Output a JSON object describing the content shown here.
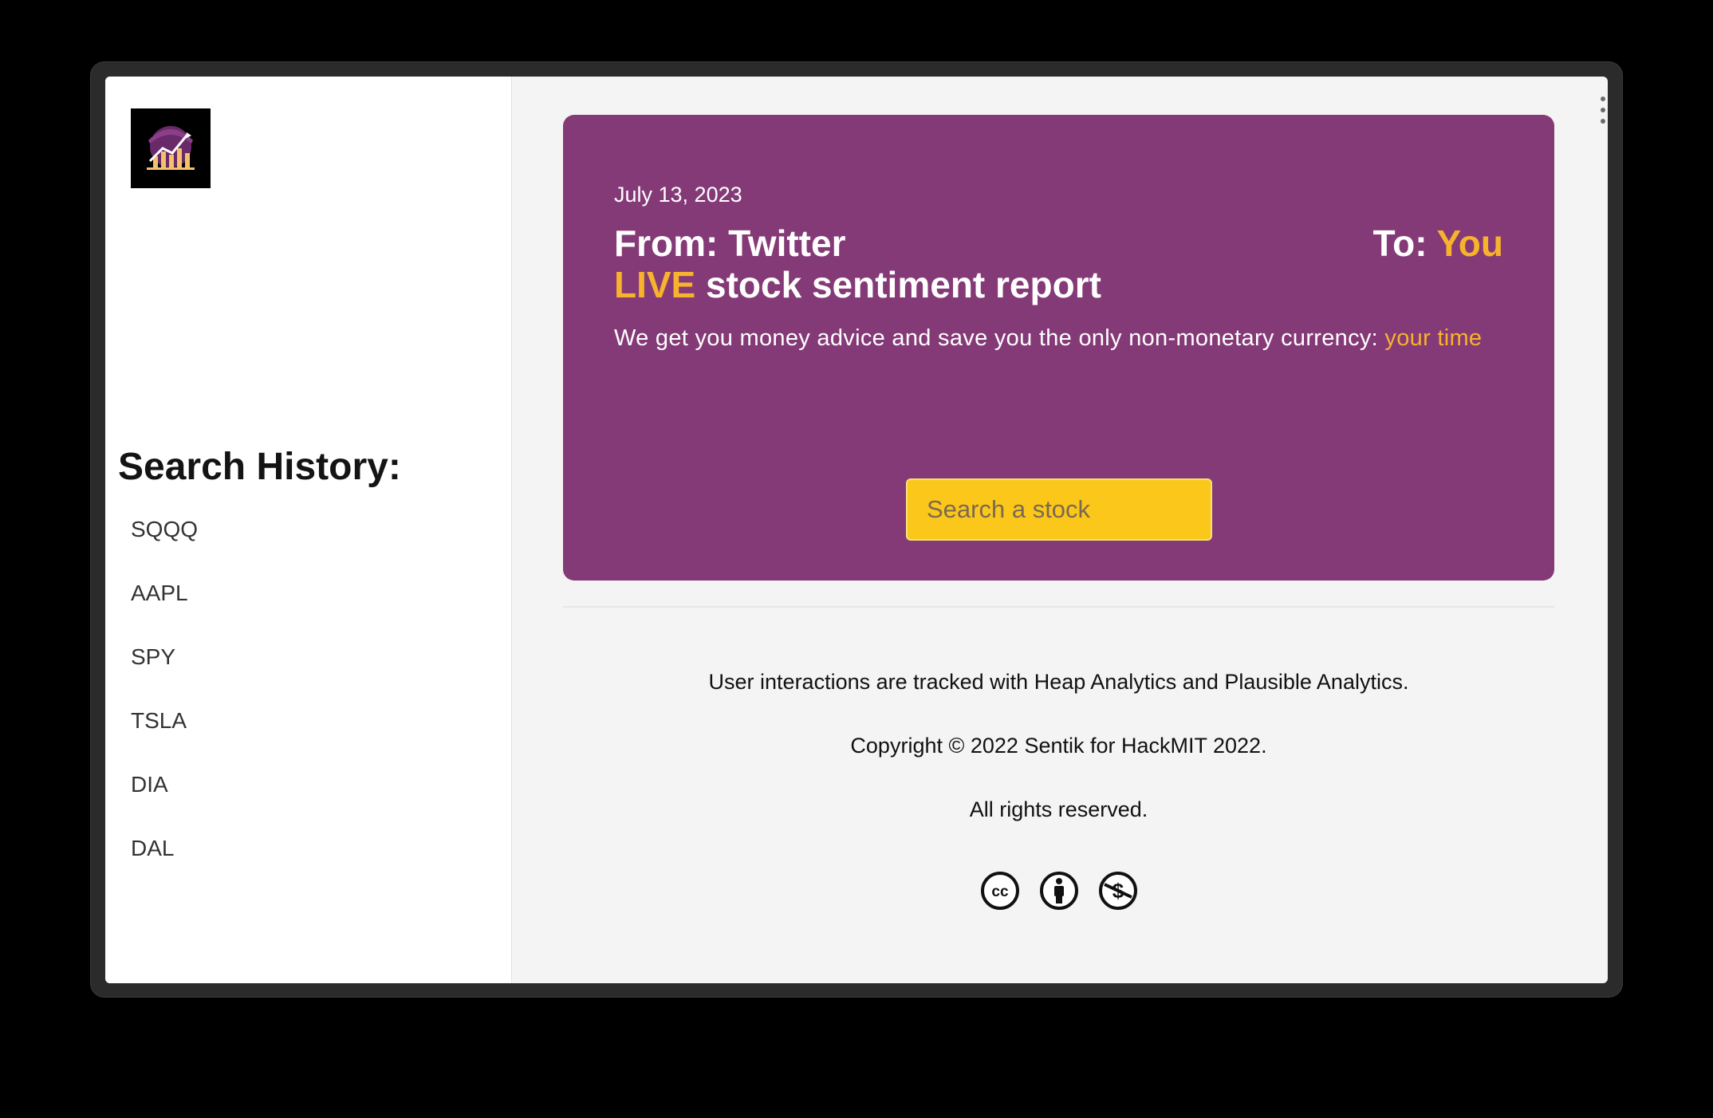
{
  "sidebar": {
    "logo_icon": "sentik-logo-icon",
    "history_title": "Search History:",
    "history": [
      "SQQQ",
      "AAPL",
      "SPY",
      "TSLA",
      "DIA",
      "DAL"
    ]
  },
  "hero": {
    "date": "July 13, 2023",
    "from_label": "From: Twitter",
    "to_label": "To: ",
    "to_value": "You",
    "live_word": "LIVE",
    "title_rest": " stock sentiment report",
    "tagline": "We get you money advice and save you the only non-monetary currency: ",
    "tagline_accent": "your time",
    "search_placeholder": "Search a stock"
  },
  "footer": {
    "tracking": "User interactions are tracked with Heap Analytics and Plausible Analytics.",
    "copyright": "Copyright © 2022 Sentik for HackMIT 2022.",
    "rights": "All rights reserved.",
    "license_icons": [
      "cc-icon",
      "attribution-icon",
      "noncommercial-icon"
    ]
  },
  "colors": {
    "hero_bg": "#853a78",
    "accent": "#f7b32b",
    "search_bg": "#fbc71a",
    "page_bg": "#f4f4f4"
  }
}
